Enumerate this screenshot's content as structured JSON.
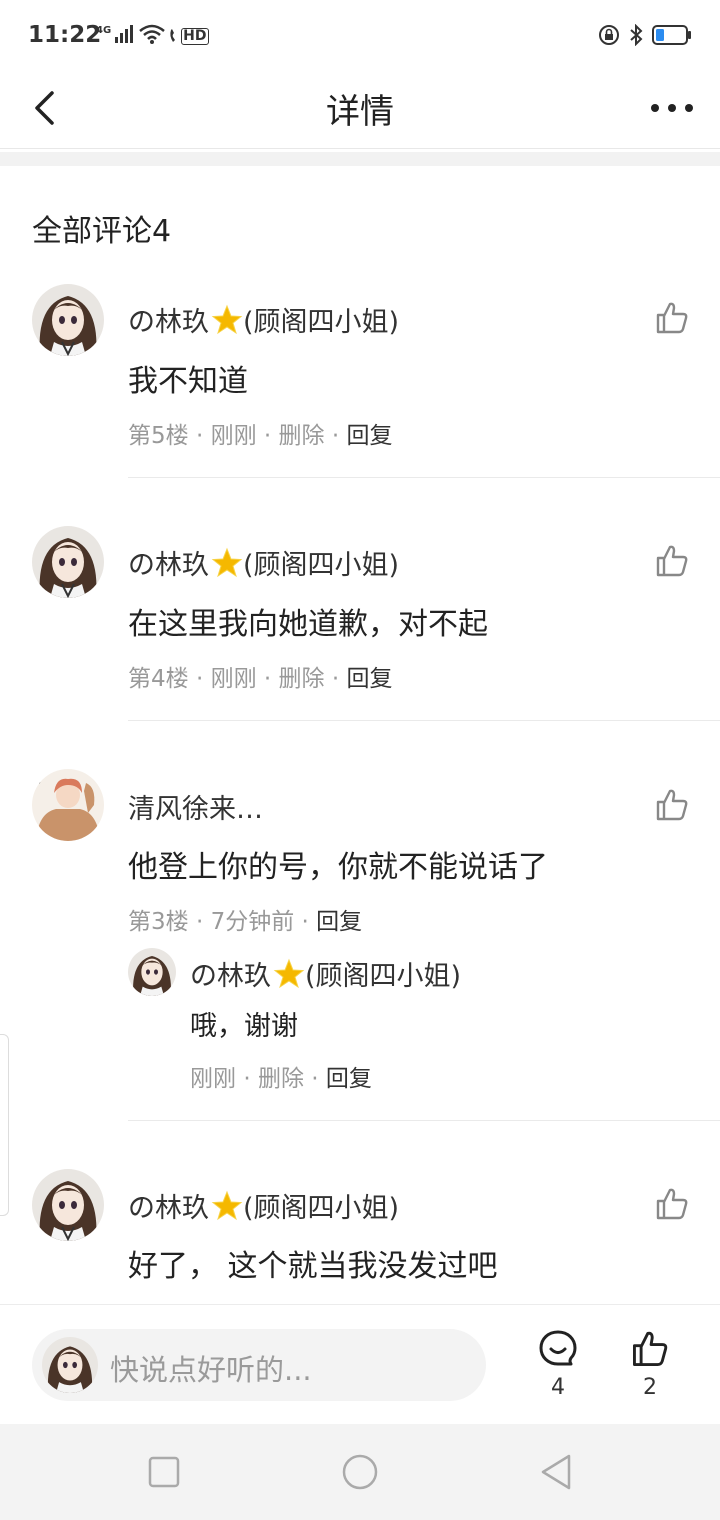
{
  "status_bar": {
    "time": "11:22",
    "network": "4G",
    "hd": "HD"
  },
  "header": {
    "title": "详情"
  },
  "comments_section": {
    "title": "全部评论4",
    "comments": [
      {
        "name": "の林玖",
        "name_suffix": "(顾阁四小姐)",
        "text": "我不知道",
        "floor": "第5楼",
        "time": "刚刚",
        "delete": "删除",
        "reply": "回复"
      },
      {
        "name": "の林玖",
        "name_suffix": "(顾阁四小姐)",
        "text": "在这里我向她道歉，对不起",
        "floor": "第4楼",
        "time": "刚刚",
        "delete": "删除",
        "reply": "回复"
      },
      {
        "name": "清风徐来…",
        "text": "他登上你的号，你就不能说话了",
        "floor": "第3楼",
        "time": "7分钟前",
        "reply": "回复",
        "sub_reply": {
          "name": "の林玖",
          "name_suffix": "(顾阁四小姐)",
          "text": "哦，谢谢",
          "time": "刚刚",
          "delete": "删除",
          "reply": "回复"
        }
      },
      {
        "name": "の林玖",
        "name_suffix": "(顾阁四小姐)",
        "text": "好了， 这个就当我没发过吧"
      }
    ]
  },
  "bottom_bar": {
    "input_placeholder": "快说点好听的...",
    "comment_count": "4",
    "like_count": "2"
  },
  "colors": {
    "text_primary": "#222222",
    "text_meta": "#999999",
    "divider": "#eaeaea",
    "star": "#f5b800"
  }
}
